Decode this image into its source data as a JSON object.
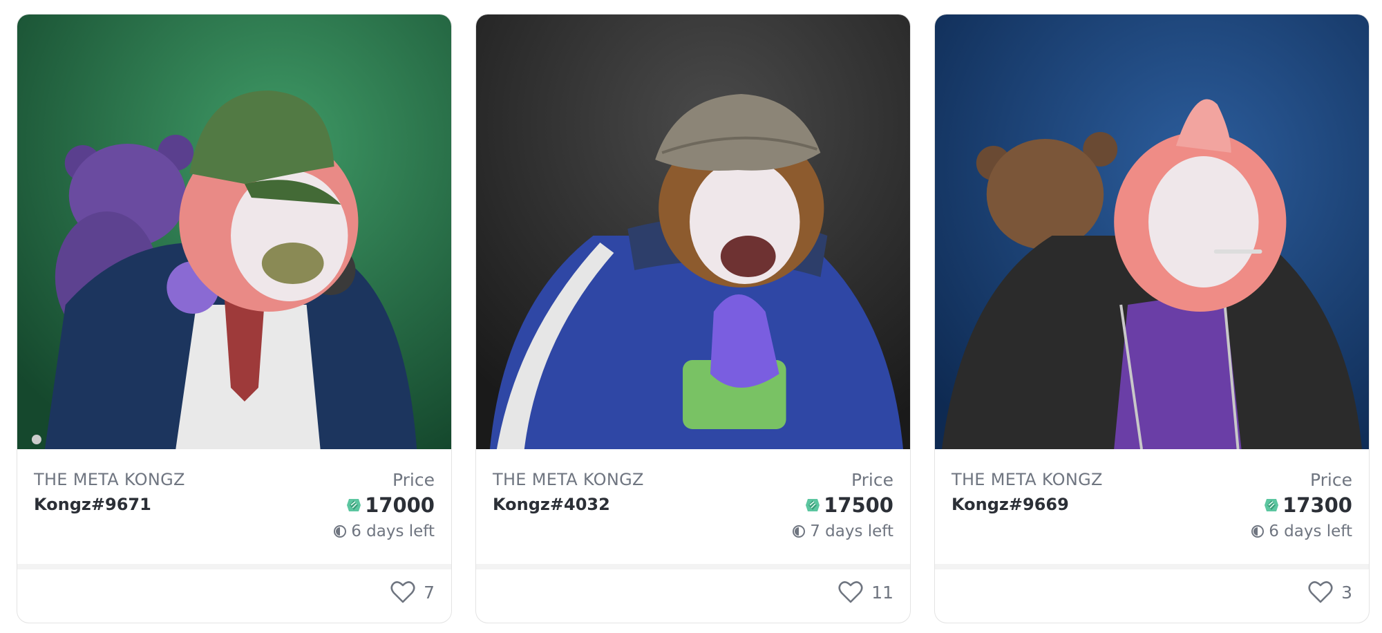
{
  "cards": [
    {
      "collection": "THE META KONGZ",
      "name": "Kongz#9671",
      "price_label": "Price",
      "price": "17000",
      "time_left": "6 days left",
      "likes": "7",
      "bg_color": "#2e7d4f",
      "fur_color": "#e98a86"
    },
    {
      "collection": "THE META KONGZ",
      "name": "Kongz#4032",
      "price_label": "Price",
      "price": "17500",
      "time_left": "7 days left",
      "likes": "11",
      "bg_color": "#3a3a3a",
      "fur_color": "#a8713e"
    },
    {
      "collection": "THE META KONGZ",
      "name": "Kongz#9669",
      "price_label": "Price",
      "price": "17300",
      "time_left": "6 days left",
      "likes": "3",
      "bg_color": "#1d4a80",
      "fur_color": "#ef8c86"
    }
  ],
  "icons": {
    "currency": "klay-token-icon",
    "timer": "clock-icon",
    "favorite": "heart-icon"
  }
}
